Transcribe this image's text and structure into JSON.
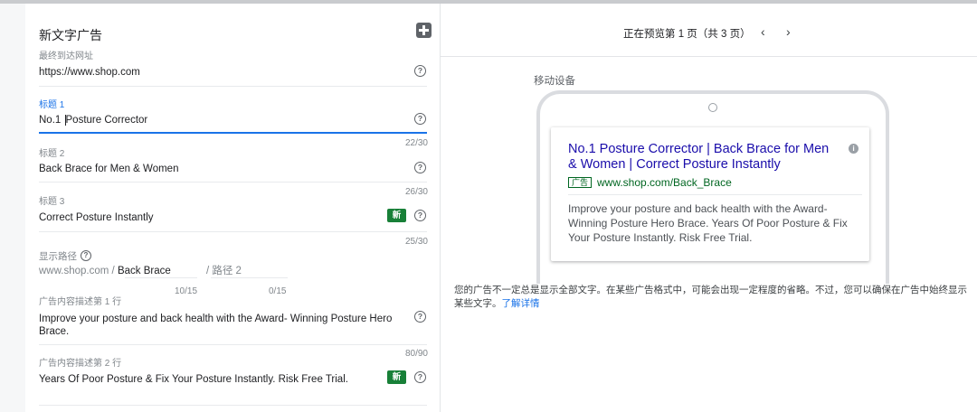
{
  "form": {
    "title": "新文字广告",
    "final_url": {
      "label": "最终到达网址",
      "value": "https://www.shop.com"
    },
    "headline1": {
      "label": "标题 1",
      "value_before_cursor": "No.1 ",
      "value_after_cursor": "Posture Corrector",
      "count": "22/30"
    },
    "headline2": {
      "label": "标题 2",
      "value": "Back Brace for Men & Women",
      "count": "26/30"
    },
    "headline3": {
      "label": "标题 3",
      "value": "Correct Posture Instantly",
      "badge": "新",
      "count": "25/30"
    },
    "display_path": {
      "label": "显示路径",
      "domain": "www.shop.com /",
      "path1": "Back Brace",
      "path2_sep": "/",
      "path2_placeholder": "路径 2",
      "path1_count": "10/15",
      "path2_count": "0/15"
    },
    "desc1": {
      "label": "广告内容描述第 1 行",
      "value": "Improve your posture and back health with the Award- Winning Posture Hero Brace.",
      "count": "80/90"
    },
    "desc2": {
      "label": "广告内容描述第 2 行",
      "value": "Years Of Poor Posture & Fix Your Posture Instantly. Risk Free Trial.",
      "badge": "新"
    }
  },
  "preview": {
    "pager_text": "正在预览第 1 页（共 3 页）",
    "prev": "‹",
    "next": "›",
    "device_label": "移动设备",
    "ad": {
      "headline": "No.1 Posture Corrector | Back Brace for Men & Women | Correct Posture Instantly",
      "badge": "广告",
      "display_url": "www.shop.com/Back_Brace",
      "description": "Improve your posture and back health with the Award- Winning Posture Hero Brace. Years Of Poor Posture & Fix Your Posture Instantly. Risk Free Trial."
    },
    "notice_text": "您的广告不一定总是显示全部文字。在某些广告格式中，可能会出现一定程度的省略。不过，您可以确保在广告中始终显示某些文字。",
    "notice_link": "了解详情"
  },
  "icons": {
    "help": "help-circle-icon",
    "add": "add-box-icon",
    "info": "info-icon"
  },
  "colors": {
    "accent": "#1a73e8",
    "new_badge": "#188038",
    "ad_title": "#1a0dab",
    "ad_url": "#006621"
  }
}
